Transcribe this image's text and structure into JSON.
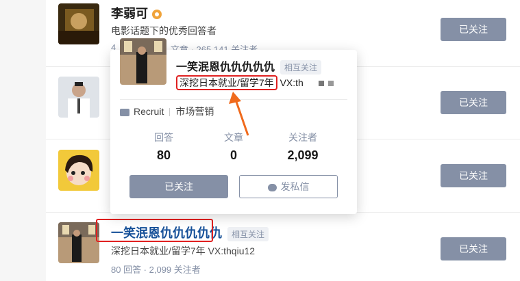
{
  "users": [
    {
      "name": "李弱可",
      "headline": "电影话题下的优秀回答者",
      "stats_visible_left": "4",
      "stats_visible_right": "文章 · 265,141 关注者",
      "follow_label": "已关注"
    },
    {
      "follow_label": "已关注"
    },
    {
      "follow_label": "已关注"
    },
    {
      "name": "一笑泯恩仇仇仇仇仇",
      "mutual_label": "相互关注",
      "headline": "深挖日本就业/留学7年 VX:thqiu12",
      "stats": "80 回答 · 2,099 关注者",
      "follow_label": "已关注"
    }
  ],
  "popup": {
    "name": "一笑泯恩仇仇仇仇仇",
    "mutual_label": "相互关注",
    "headline_highlight": "深挖日本就业/留学7年",
    "headline_rest": " VX:th",
    "company": "Recruit",
    "position": "市场营销",
    "stats": [
      {
        "label": "回答",
        "value": "80"
      },
      {
        "label": "文章",
        "value": "0"
      },
      {
        "label": "关注者",
        "value": "2,099"
      }
    ],
    "follow_label": "已关注",
    "message_label": "发私信"
  },
  "colors": {
    "button_gray": "#8590a6",
    "highlight_red": "#e02020",
    "arrow_orange": "#f06a1c",
    "badge_gold": "#f0a33a"
  },
  "icons": [
    "gold-badge-icon",
    "briefcase-icon",
    "chat-icon",
    "arrow-annotation"
  ]
}
